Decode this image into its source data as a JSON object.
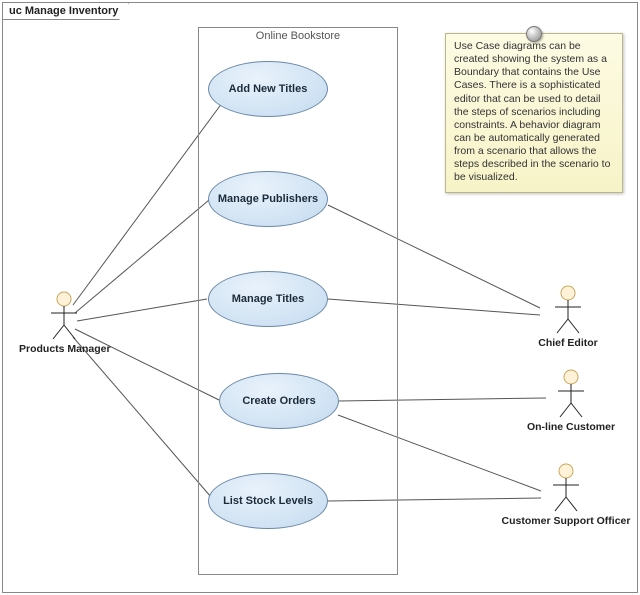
{
  "diagram": {
    "frame_title": "uc Manage Inventory",
    "system_name": "Online Bookstore"
  },
  "actors": {
    "products_manager": "Products Manager",
    "chief_editor": "Chief Editor",
    "online_customer": "On-line Customer",
    "customer_support_officer": "Customer Support Officer"
  },
  "usecases": {
    "add_new_titles": "Add New Titles",
    "manage_publishers": "Manage Publishers",
    "manage_titles": "Manage Titles",
    "create_orders": "Create Orders",
    "list_stock_levels": "List Stock Levels"
  },
  "note": {
    "text": "Use Case diagrams can be created showing the system as a Boundary that contains the Use Cases. There is a sophisticated editor that can be used to detail the steps of scenarios including constraints. A behavior diagram can be automatically generated from a scenario that allows the steps described in the scenario to be visualized."
  },
  "associations": [
    {
      "from": "products_manager",
      "to": "add_new_titles"
    },
    {
      "from": "products_manager",
      "to": "manage_publishers"
    },
    {
      "from": "products_manager",
      "to": "manage_titles"
    },
    {
      "from": "products_manager",
      "to": "create_orders"
    },
    {
      "from": "products_manager",
      "to": "list_stock_levels"
    },
    {
      "from": "manage_publishers",
      "to": "chief_editor"
    },
    {
      "from": "manage_titles",
      "to": "chief_editor"
    },
    {
      "from": "create_orders",
      "to": "online_customer"
    },
    {
      "from": "list_stock_levels",
      "to": "customer_support_officer"
    },
    {
      "from": "create_orders",
      "to": "customer_support_officer"
    }
  ]
}
